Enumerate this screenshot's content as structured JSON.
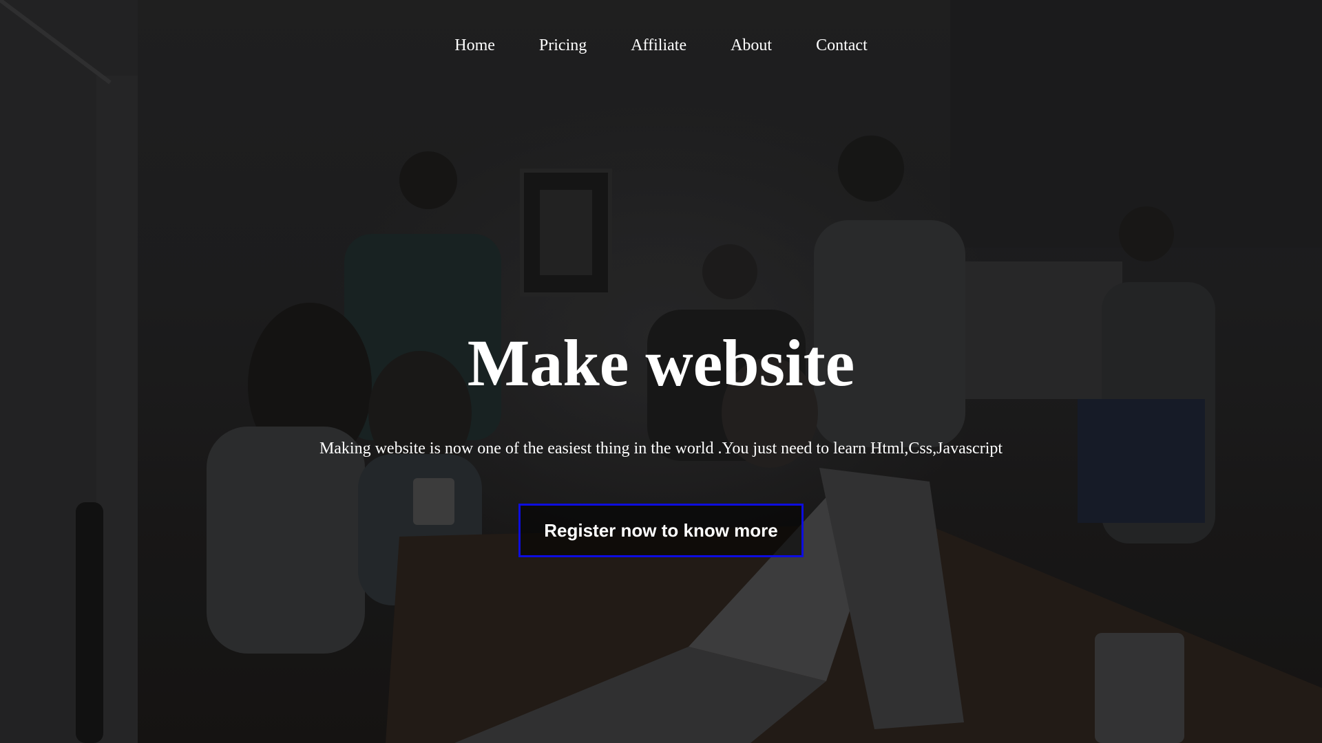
{
  "nav": {
    "items": [
      {
        "label": "Home"
      },
      {
        "label": "Pricing"
      },
      {
        "label": "Affiliate"
      },
      {
        "label": "About"
      },
      {
        "label": "Contact"
      }
    ]
  },
  "hero": {
    "title": "Make website",
    "subtitle": "Making website is now one of the easiest thing in the world .You just need to learn Html,Css,Javascript",
    "cta_label": "Register now to know more"
  },
  "colors": {
    "text": "#ffffff",
    "cta_border": "#0d0de0",
    "background": "#1f1f20"
  }
}
